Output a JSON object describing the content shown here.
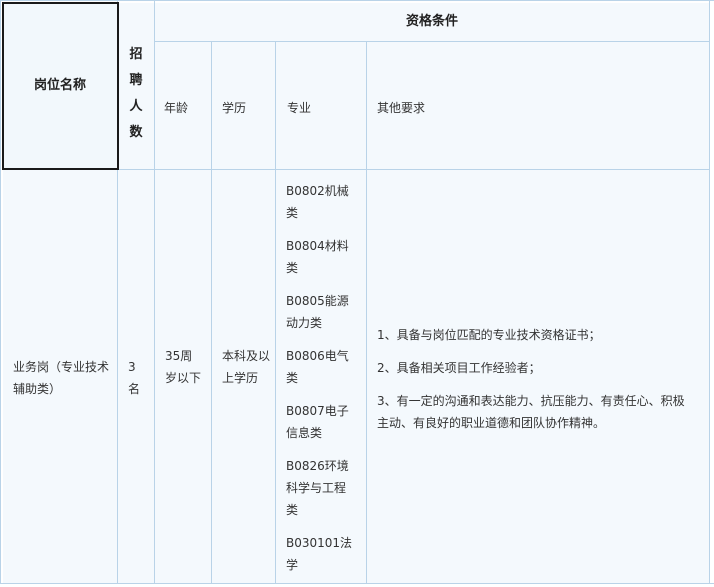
{
  "header": {
    "position_name": "岗位名称",
    "recruit_count": [
      "招",
      "聘",
      "人",
      "数"
    ],
    "qualification": "资格条件",
    "age": "年龄",
    "education": "学历",
    "major": "专业",
    "other": "其他要求"
  },
  "row": {
    "position": "业务岗（专业技术辅助类）",
    "count": "3名",
    "age": "35周岁以下",
    "education": "本科及以上学历",
    "majors": [
      "B0802机械类",
      "B0804材料类",
      "B0805能源动力类",
      "B0806电气类",
      "B0807电子信息类",
      "B0826环境科学与工程类",
      "B030101法学"
    ],
    "requirements": [
      "1、具备与岗位匹配的专业技术资格证书；",
      "2、具备相关项目工作经验者；",
      "3、有一定的沟通和表达能力、抗压能力、有责任心、积极主动、有良好的职业道德和团队协作精神。"
    ]
  }
}
